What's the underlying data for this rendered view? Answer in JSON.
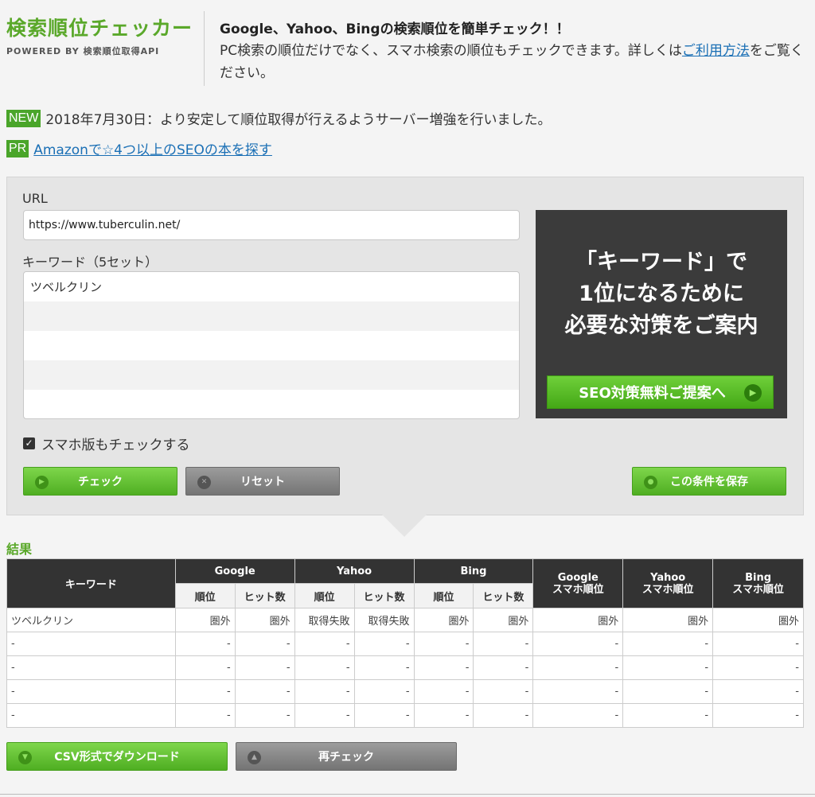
{
  "header": {
    "logo_title": "検索順位チェッカー",
    "logo_sub": "POWERED BY 検索順位取得API",
    "headline": "Google、Yahoo、Bingの検索順位を簡単チェック！！",
    "desc_before": "PC検索の順位だけでなく、スマホ検索の順位もチェックできます。詳しくは",
    "desc_link": "ご利用方法",
    "desc_after": "をご覧ください。"
  },
  "news": {
    "tag": "NEW",
    "text": "2018年7月30日：より安定して順位取得が行えるようサーバー増強を行いました。"
  },
  "promo": {
    "tag": "PR",
    "link": "Amazonで☆4つ以上のSEOの本を探す"
  },
  "form": {
    "url_label": "URL",
    "url_value": "https://www.tuberculin.net/",
    "keyword_label": "キーワード（5セット）",
    "keywords": [
      "ツベルクリン",
      "",
      "",
      "",
      ""
    ],
    "smartphone_checkbox": "スマホ版もチェックする",
    "check_button": "チェック",
    "reset_button": "リセット",
    "save_button": "この条件を保存"
  },
  "ad": {
    "line1": "「キーワード」で",
    "line2": "1位になるために",
    "line3": "必要な対策をご案内",
    "button": "SEO対策無料ご提案へ"
  },
  "results": {
    "heading": "結果",
    "col_keyword": "キーワード",
    "col_google": "Google",
    "col_yahoo": "Yahoo",
    "col_bing": "Bing",
    "col_rank": "順位",
    "col_hits": "ヒット数",
    "col_google_sp": "Google\nスマホ順位",
    "col_yahoo_sp": "Yahoo\nスマホ順位",
    "col_bing_sp": "Bing\nスマホ順位",
    "rows": [
      [
        "ツベルクリン",
        "圏外",
        "圏外",
        "取得失敗",
        "取得失敗",
        "圏外",
        "圏外",
        "圏外",
        "圏外",
        "圏外"
      ],
      [
        "-",
        "-",
        "-",
        "-",
        "-",
        "-",
        "-",
        "-",
        "-",
        "-"
      ],
      [
        "-",
        "-",
        "-",
        "-",
        "-",
        "-",
        "-",
        "-",
        "-",
        "-"
      ],
      [
        "-",
        "-",
        "-",
        "-",
        "-",
        "-",
        "-",
        "-",
        "-",
        "-"
      ],
      [
        "-",
        "-",
        "-",
        "-",
        "-",
        "-",
        "-",
        "-",
        "-",
        "-"
      ]
    ],
    "csv_button": "CSV形式でダウンロード",
    "recheck_button": "再チェック"
  },
  "colors": {
    "brand_green": "#5aa82a",
    "link_blue": "#1a6fb5",
    "header_dark": "#333333"
  }
}
